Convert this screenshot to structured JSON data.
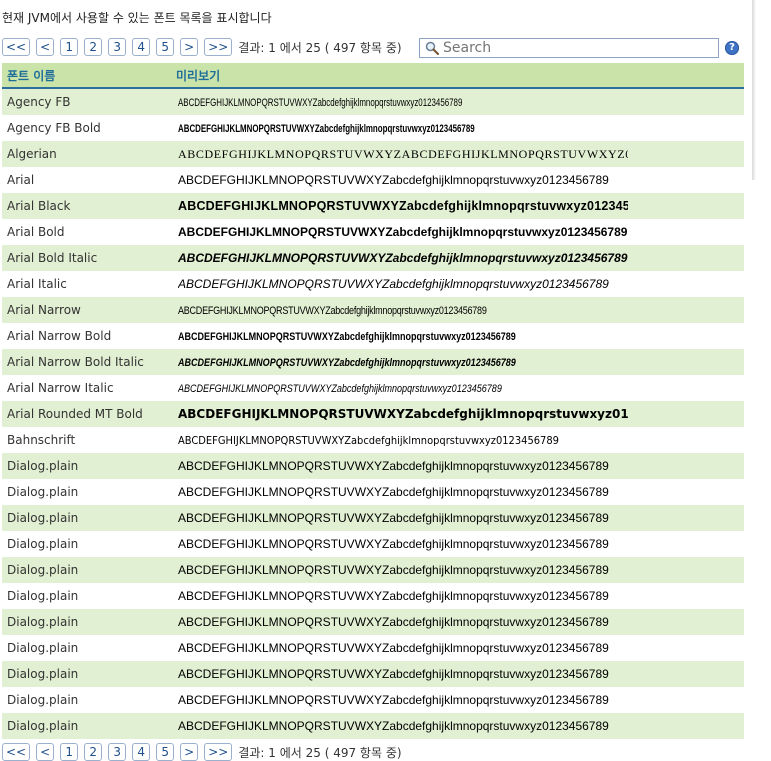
{
  "description": "현재 JVM에서 사용할 수 있는 폰트 목록을 표시합니다",
  "pager": {
    "first": "<<",
    "prev": "<",
    "pages": [
      "1",
      "2",
      "3",
      "4",
      "5"
    ],
    "next": ">",
    "last": ">>",
    "info": "결과: 1 에서 25 ( 497 항목 중)"
  },
  "search": {
    "placeholder": "Search"
  },
  "help_label": "?",
  "table": {
    "headers": [
      "폰트 이름",
      "미리보기"
    ],
    "rows": [
      {
        "name": "Agency FB",
        "preview": "ABCDEFGHIJKLMNOPQRSTUVWXYZabcdefghijklmnopqrstuvwxyz0123456789",
        "style": "f-agency"
      },
      {
        "name": "Agency FB Bold",
        "preview": "ABCDEFGHIJKLMNOPQRSTUVWXYZabcdefghijklmnopqrstuvwxyz0123456789",
        "style": "f-agencybold"
      },
      {
        "name": "Algerian",
        "preview": "ABCDEFGHIJKLMNOPQRSTUVWXYZABCDEFGHIJKLMNOPQRSTUVWXYZ0123456789",
        "style": "f-serif"
      },
      {
        "name": "Arial",
        "preview": "ABCDEFGHIJKLMNOPQRSTUVWXYZabcdefghijklmnopqrstuvwxyz0123456789",
        "style": "f-plain"
      },
      {
        "name": "Arial Black",
        "preview": "ABCDEFGHIJKLMNOPQRSTUVWXYZabcdefghijklmnopqrstuvwxyz0123456789",
        "style": "f-black"
      },
      {
        "name": "Arial Bold",
        "preview": "ABCDEFGHIJKLMNOPQRSTUVWXYZabcdefghijklmnopqrstuvwxyz0123456789",
        "style": "f-bold"
      },
      {
        "name": "Arial Bold Italic",
        "preview": "ABCDEFGHIJKLMNOPQRSTUVWXYZabcdefghijklmnopqrstuvwxyz0123456789",
        "style": "f-bolditalic"
      },
      {
        "name": "Arial Italic",
        "preview": "ABCDEFGHIJKLMNOPQRSTUVWXYZabcdefghijklmnopqrstuvwxyz0123456789",
        "style": "f-italic"
      },
      {
        "name": "Arial Narrow",
        "preview": "ABCDEFGHIJKLMNOPQRSTUVWXYZabcdefghijklmnopqrstuvwxyz0123456789",
        "style": "f-narrow"
      },
      {
        "name": "Arial Narrow Bold",
        "preview": "ABCDEFGHIJKLMNOPQRSTUVWXYZabcdefghijklmnopqrstuvwxyz0123456789",
        "style": "f-narrowbold"
      },
      {
        "name": "Arial Narrow Bold Italic",
        "preview": "ABCDEFGHIJKLMNOPQRSTUVWXYZabcdefghijklmnopqrstuvwxyz0123456789",
        "style": "f-narrowbi"
      },
      {
        "name": "Arial Narrow Italic",
        "preview": "ABCDEFGHIJKLMNOPQRSTUVWXYZabcdefghijklmnopqrstuvwxyz0123456789",
        "style": "f-narrowi"
      },
      {
        "name": "Arial Rounded MT Bold",
        "preview": "ABCDEFGHIJKLMNOPQRSTUVWXYZabcdefghijklmnopqrstuvwxyz0123456789",
        "style": "f-rounded"
      },
      {
        "name": "Bahnschrift",
        "preview": "ABCDEFGHIJKLMNOPQRSTUVWXYZabcdefghijklmnopqrstuvwxyz0123456789",
        "style": "f-bahn"
      },
      {
        "name": "Dialog.plain",
        "preview": "ABCDEFGHIJKLMNOPQRSTUVWXYZabcdefghijklmnopqrstuvwxyz0123456789",
        "style": "f-plain"
      },
      {
        "name": "Dialog.plain",
        "preview": "ABCDEFGHIJKLMNOPQRSTUVWXYZabcdefghijklmnopqrstuvwxyz0123456789",
        "style": "f-plain"
      },
      {
        "name": "Dialog.plain",
        "preview": "ABCDEFGHIJKLMNOPQRSTUVWXYZabcdefghijklmnopqrstuvwxyz0123456789",
        "style": "f-plain"
      },
      {
        "name": "Dialog.plain",
        "preview": "ABCDEFGHIJKLMNOPQRSTUVWXYZabcdefghijklmnopqrstuvwxyz0123456789",
        "style": "f-plain"
      },
      {
        "name": "Dialog.plain",
        "preview": "ABCDEFGHIJKLMNOPQRSTUVWXYZabcdefghijklmnopqrstuvwxyz0123456789",
        "style": "f-plain"
      },
      {
        "name": "Dialog.plain",
        "preview": "ABCDEFGHIJKLMNOPQRSTUVWXYZabcdefghijklmnopqrstuvwxyz0123456789",
        "style": "f-plain"
      },
      {
        "name": "Dialog.plain",
        "preview": "ABCDEFGHIJKLMNOPQRSTUVWXYZabcdefghijklmnopqrstuvwxyz0123456789",
        "style": "f-plain"
      },
      {
        "name": "Dialog.plain",
        "preview": "ABCDEFGHIJKLMNOPQRSTUVWXYZabcdefghijklmnopqrstuvwxyz0123456789",
        "style": "f-plain"
      },
      {
        "name": "Dialog.plain",
        "preview": "ABCDEFGHIJKLMNOPQRSTUVWXYZabcdefghijklmnopqrstuvwxyz0123456789",
        "style": "f-plain"
      },
      {
        "name": "Dialog.plain",
        "preview": "ABCDEFGHIJKLMNOPQRSTUVWXYZabcdefghijklmnopqrstuvwxyz0123456789",
        "style": "f-plain"
      },
      {
        "name": "Dialog.plain",
        "preview": "ABCDEFGHIJKLMNOPQRSTUVWXYZabcdefghijklmnopqrstuvwxyz0123456789",
        "style": "f-plain"
      }
    ]
  },
  "colors": {
    "header_bg": "#c9e3a8",
    "header_text": "#1f6e9a",
    "row_alt_bg": "#e1efd2",
    "pager_border": "#9ab0cc"
  },
  "icons": {
    "search": "search-icon",
    "help": "help-icon"
  }
}
